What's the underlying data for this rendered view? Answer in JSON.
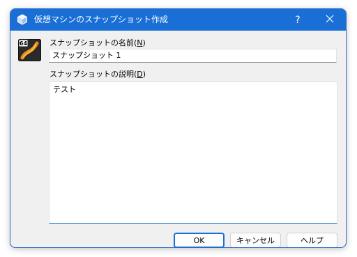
{
  "window": {
    "title": "仮想マシンのスナップショット作成",
    "help_glyph": "?",
    "close_glyph": "✕",
    "accent_color": "#1a6fd6"
  },
  "form": {
    "name_label": "スナップショットの名前(",
    "name_mnemonic": "N",
    "name_label_close": ")",
    "name_value": "スナップショット 1",
    "desc_label": "スナップショットの説明(",
    "desc_mnemonic": "D",
    "desc_label_close": ")",
    "desc_value": "テスト"
  },
  "icons": {
    "title": "virtualbox-cube-icon",
    "app": "64-bit-os-icon",
    "app_badge": "64"
  },
  "buttons": {
    "ok": "OK",
    "cancel": "キャンセル",
    "help": "ヘルプ"
  }
}
